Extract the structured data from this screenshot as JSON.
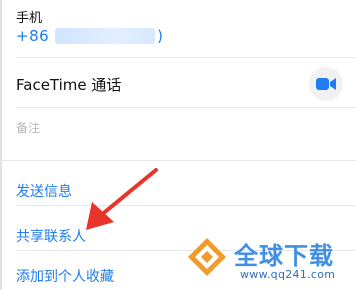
{
  "phone": {
    "label": "手机",
    "prefix": "+86",
    "suffix": ")"
  },
  "facetime": {
    "label": "FaceTime 通话",
    "icon": "video-camera-icon"
  },
  "notes": {
    "placeholder": "备注"
  },
  "actions": [
    {
      "label": "发送信息"
    },
    {
      "label": "共享联系人"
    },
    {
      "label": "添加到个人收藏"
    }
  ],
  "watermark": {
    "title": "全球下载",
    "url": "www.qq241.com",
    "icon": "download-logo-icon"
  },
  "colors": {
    "accent": "#1f7cf2",
    "arrow": "#e8342a",
    "watermark": "#3f8fe4"
  }
}
